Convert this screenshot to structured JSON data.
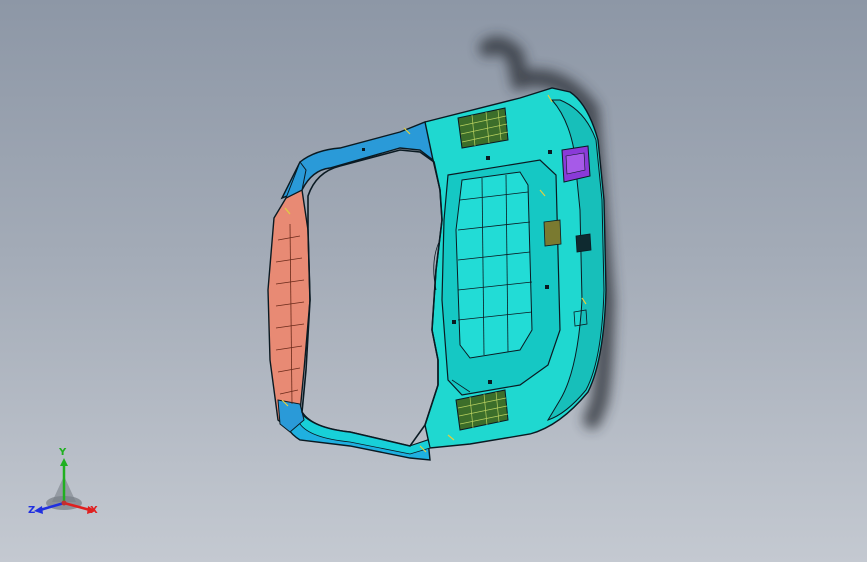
{
  "colors": {
    "background_top": "#8d97a6",
    "background_bottom": "#c4c9d1",
    "part_cyan": "#1fd8d0",
    "part_blue": "#2a9ad8",
    "part_salmon": "#e88a74",
    "part_green": "#3c6e2a",
    "part_purple": "#8a3ad8",
    "edge": "#0a1a22",
    "axis_x": "#e02020",
    "axis_y": "#20b020",
    "axis_z": "#2030e0"
  },
  "triad": {
    "x_label": "X",
    "y_label": "Y",
    "z_label": "Z"
  }
}
